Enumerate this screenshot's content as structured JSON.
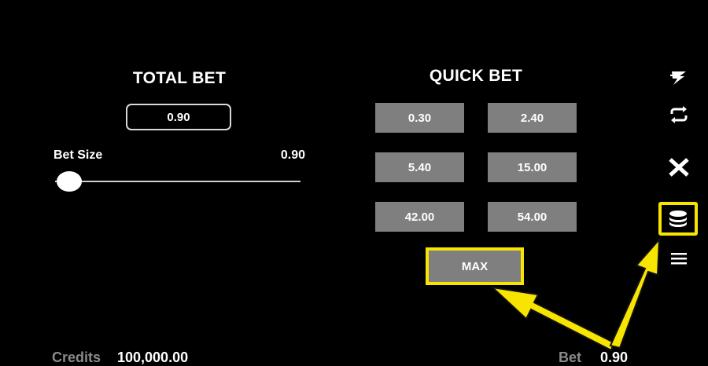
{
  "total_bet": {
    "title": "TOTAL BET",
    "value": "0.90",
    "bet_size_label": "Bet Size",
    "bet_size_value": "0.90",
    "slider_level": 0.0
  },
  "quick_bet": {
    "title": "QUICK BET",
    "options": [
      "0.30",
      "2.40",
      "5.40",
      "15.00",
      "42.00",
      "54.00"
    ],
    "max_label": "MAX"
  },
  "sidebar": {
    "icons": [
      "lightning-icon",
      "autoplay-icon",
      "close-icon",
      "coins-icon",
      "menu-icon"
    ]
  },
  "footer": {
    "credits_label": "Credits",
    "credits_value": "100,000.00",
    "bet_label": "Bet",
    "bet_value": "0.90"
  },
  "colors": {
    "background": "#000000",
    "button_gray": "#7f7f7f",
    "highlight_yellow": "#f7e400",
    "muted_text": "#8a8a8a"
  }
}
